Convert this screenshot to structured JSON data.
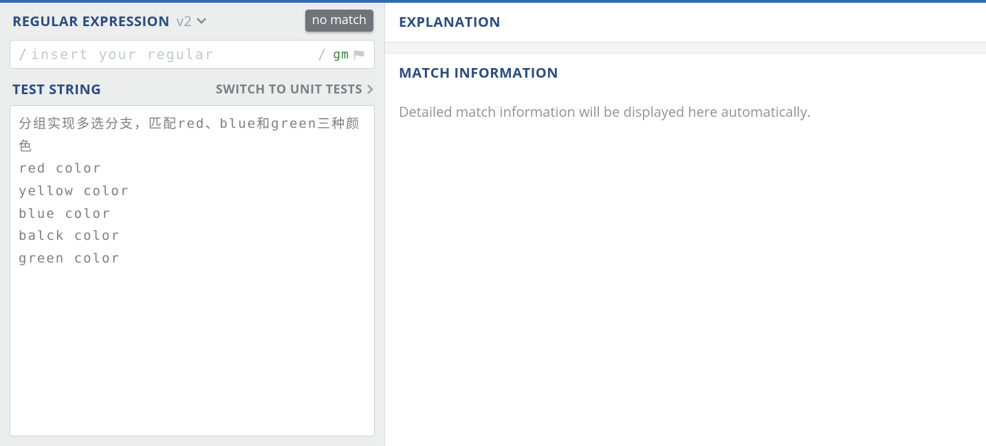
{
  "left": {
    "regex_title": "REGULAR EXPRESSION",
    "version_label": "v2",
    "no_match_badge": "no match",
    "slash": "/",
    "regex_placeholder": "insert your regular",
    "regex_value": "",
    "flags_text": "gm",
    "test_string_title": "TEST STRING",
    "switch_unit_label": "SWITCH TO UNIT TESTS",
    "test_string_value": "分组实现多选分支，匹配red、blue和green三种颜色\nred color\nyellow color\nblue color\nbalck color\ngreen color"
  },
  "right": {
    "explanation_title": "EXPLANATION",
    "match_info_title": "MATCH INFORMATION",
    "match_info_placeholder": "Detailed match information will be displayed here automatically."
  }
}
